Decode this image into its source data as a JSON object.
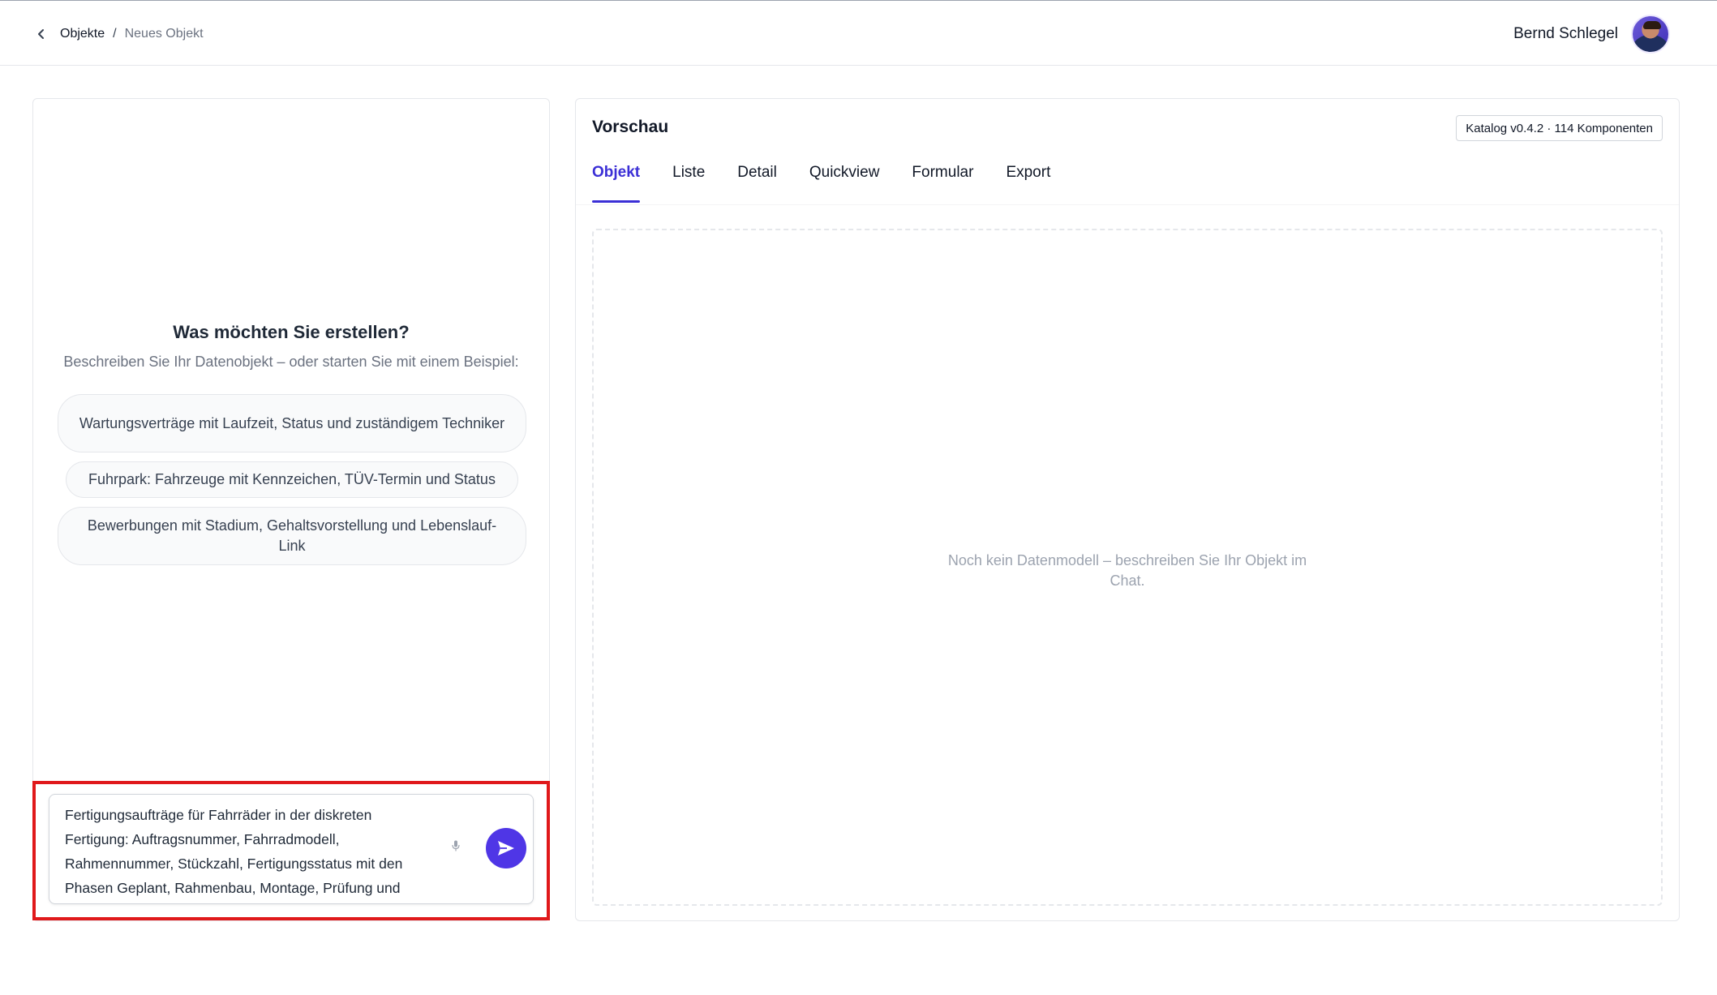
{
  "breadcrumb": {
    "root": "Objekte",
    "separator": "/",
    "current": "Neues Objekt"
  },
  "user": {
    "name": "Bernd Schlegel"
  },
  "chat": {
    "intro_title": "Was möchten Sie erstellen?",
    "intro_subtitle": "Beschreiben Sie Ihr Datenobjekt – oder starten Sie mit einem Beispiel:",
    "examples": [
      "Wartungsverträge mit Laufzeit, Status und zuständigem Techniker",
      "Fuhrpark: Fahrzeuge mit Kennzeichen, TÜV-Termin und Status",
      "Bewerbungen mit Stadium, Gehaltsvorstellung und Lebenslauf-Link"
    ],
    "composer_value": "Fertigungsaufträge für Fahrräder in der diskreten Fertigung: Auftragsnummer, Fahrradmodell, Rahmennummer, Stückzahl, Fertigungsstatus mit den Phasen Geplant, Rahmenbau, Montage, Prüfung und"
  },
  "preview": {
    "title": "Vorschau",
    "catalog_badge": "Katalog v0.4.2 · 114 Komponenten",
    "tabs": [
      "Objekt",
      "Liste",
      "Detail",
      "Quickview",
      "Formular",
      "Export"
    ],
    "active_tab": "Objekt",
    "empty_message": "Noch kein Datenmodell – beschreiben Sie Ihr Objekt im Chat."
  },
  "colors": {
    "accent": "#4f36e6",
    "highlight": "#e0191b"
  },
  "icons": {
    "back": "chevron-left-icon",
    "mic": "microphone-icon",
    "send": "send-icon"
  }
}
